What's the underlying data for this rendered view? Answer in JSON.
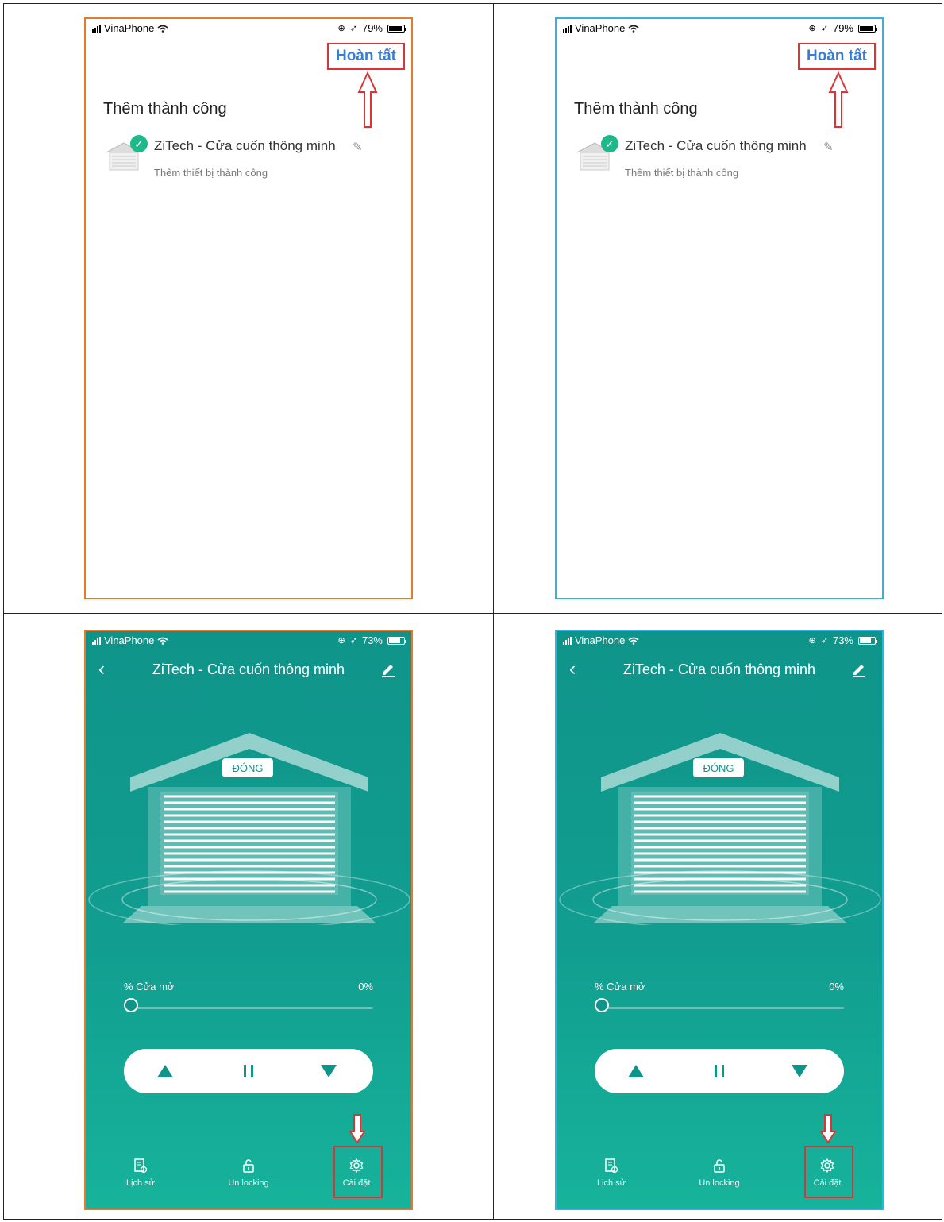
{
  "phones": [
    {
      "status": {
        "carrier": "VinaPhone",
        "battery": "79%"
      },
      "done_label": "Hoàn tất",
      "heading": "Thêm thành công",
      "device": {
        "name": "ZiTech - Cửa cuốn thông minh",
        "sub": "Thêm thiết bị thành công"
      }
    },
    {
      "status": {
        "carrier": "VinaPhone",
        "battery": "79%"
      },
      "done_label": "Hoàn tất",
      "heading": "Thêm thành công",
      "device": {
        "name": "ZiTech - Cửa cuốn thông minh",
        "sub": "Thêm thiết bị thành công"
      }
    },
    {
      "status": {
        "carrier": "VinaPhone",
        "battery": "73%"
      },
      "title": "ZiTech - Cửa cuốn thông minh",
      "door_state": "ĐÓNG",
      "open_label": "% Cửa mở",
      "open_value": "0%",
      "tabs": {
        "history": "Lịch sử",
        "unlock": "Un locking",
        "settings": "Cài đặt"
      }
    },
    {
      "status": {
        "carrier": "VinaPhone",
        "battery": "73%"
      },
      "title": "ZiTech - Cửa cuốn thông minh",
      "door_state": "ĐÓNG",
      "open_label": "% Cửa mở",
      "open_value": "0%",
      "tabs": {
        "history": "Lịch sử",
        "unlock": "Un locking",
        "settings": "Cài đặt"
      }
    }
  ],
  "colors": {
    "accent_teal": "#0f948a",
    "highlight_red": "#dd3333",
    "link_blue": "#3b7bd0",
    "frame_orange": "#e67a2a",
    "frame_blue": "#2fb2e6"
  },
  "icons": [
    "signal-icon",
    "wifi-icon",
    "lock-rotation-icon",
    "location-icon",
    "battery-icon",
    "check-icon",
    "pencil-icon",
    "back-icon",
    "up-icon",
    "pause-icon",
    "down-icon",
    "history-icon",
    "unlock-icon",
    "gear-icon"
  ]
}
